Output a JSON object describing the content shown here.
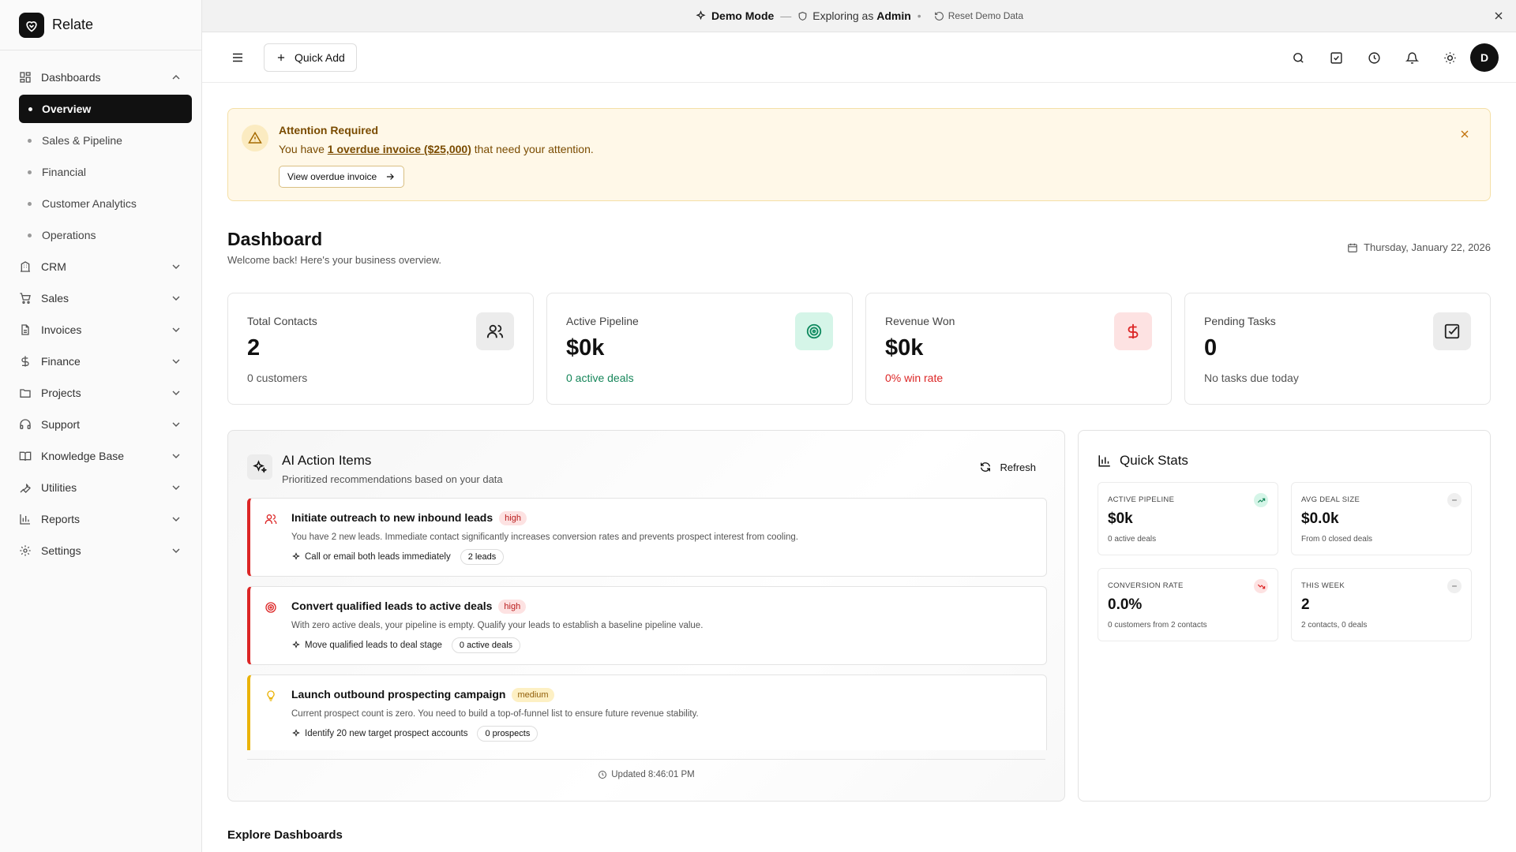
{
  "app": {
    "name": "Relate"
  },
  "demo_bar": {
    "mode": "Demo Mode",
    "exploring_prefix": "Exploring as",
    "role": "Admin",
    "reset": "Reset Demo Data"
  },
  "sidebar": {
    "dashboards": {
      "label": "Dashboards",
      "items": [
        "Overview",
        "Sales & Pipeline",
        "Financial",
        "Customer Analytics",
        "Operations"
      ],
      "active": "Overview"
    },
    "groups": [
      "CRM",
      "Sales",
      "Invoices",
      "Finance",
      "Projects",
      "Support",
      "Knowledge Base",
      "Utilities",
      "Reports",
      "Settings"
    ]
  },
  "topbar": {
    "quick_add": "Quick Add",
    "avatar_initial": "D"
  },
  "alert": {
    "title": "Attention Required",
    "msg_prefix": "You have",
    "msg_link": "1 overdue invoice ($25,000)",
    "msg_suffix": "that need your attention.",
    "button": "View overdue invoice"
  },
  "header": {
    "title": "Dashboard",
    "subtitle": "Welcome back! Here's your business overview.",
    "date": "Thursday, January 22, 2026"
  },
  "kpis": [
    {
      "label": "Total Contacts",
      "value": "2",
      "sub": "0 customers",
      "sub_color": "#555555",
      "icon": "users-icon"
    },
    {
      "label": "Active Pipeline",
      "value": "$0k",
      "sub": "0 active deals",
      "sub_color": "#16865a",
      "icon": "target-icon"
    },
    {
      "label": "Revenue Won",
      "value": "$0k",
      "sub": "0% win rate",
      "sub_color": "#dc2626",
      "icon": "dollar-icon"
    },
    {
      "label": "Pending Tasks",
      "value": "0",
      "sub": "No tasks due today",
      "sub_color": "#555555",
      "icon": "checkbox-icon"
    }
  ],
  "ai": {
    "title": "AI Action Items",
    "subtitle": "Prioritized recommendations based on your data",
    "refresh": "Refresh",
    "updated": "Updated 8:46:01 PM",
    "items": [
      {
        "title": "Initiate outreach to new inbound leads",
        "priority": "high",
        "desc": "You have 2 new leads. Immediate contact significantly increases conversion rates and prevents prospect interest from cooling.",
        "action": "Call or email both leads immediately",
        "pill": "2 leads",
        "icon": "users-icon"
      },
      {
        "title": "Convert qualified leads to active deals",
        "priority": "high",
        "desc": "With zero active deals, your pipeline is empty. Qualify your leads to establish a baseline pipeline value.",
        "action": "Move qualified leads to deal stage",
        "pill": "0 active deals",
        "icon": "target-icon"
      },
      {
        "title": "Launch outbound prospecting campaign",
        "priority": "medium",
        "desc": "Current prospect count is zero. You need to build a top-of-funnel list to ensure future revenue stability.",
        "action": "Identify 20 new target prospect accounts",
        "pill": "0 prospects",
        "icon": "lightbulb-icon"
      }
    ]
  },
  "quick_stats": {
    "title": "Quick Stats",
    "stats": [
      {
        "label": "ACTIVE PIPELINE",
        "value": "$0k",
        "sub": "0 active deals",
        "trend": "up"
      },
      {
        "label": "AVG DEAL SIZE",
        "value": "$0.0k",
        "sub": "From 0 closed deals",
        "trend": "flat"
      },
      {
        "label": "CONVERSION RATE",
        "value": "0.0%",
        "sub": "0 customers from 2 contacts",
        "trend": "down"
      },
      {
        "label": "THIS WEEK",
        "value": "2",
        "sub": "2 contacts, 0 deals",
        "trend": "flat"
      }
    ]
  },
  "explore": {
    "title": "Explore Dashboards"
  }
}
